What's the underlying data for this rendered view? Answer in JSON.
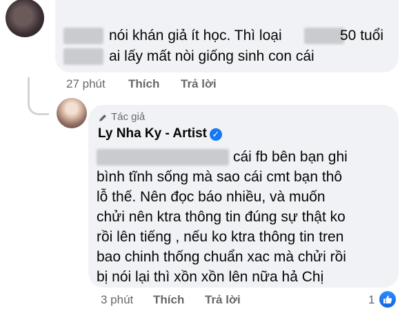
{
  "comment1": {
    "lines": [
      "nói khán giả ít học.  Thì loại",
      "50 tuổi",
      "ai lấy mất nòi giống sinh con cái"
    ],
    "time": "27 phút",
    "like": "Thích",
    "reply": "Trả lời"
  },
  "comment2": {
    "author_tag": "Tác giả",
    "author": "Ly Nha Ky - Artist",
    "lines": [
      "cái fb bên bạn ghi",
      "bình tĩnh sống mà sao cái cmt bạn thô",
      "lỗ thế. Nên đọc báo nhiều, và muốn",
      "chửi nên ktra thông tin đúng sự thật ko",
      "rồi lên tiếng , nếu ko ktra thông tin tren",
      "bao chinh thống chuẩn xac mà chửi rồi",
      "bị nói lại thì xồn xồn  lên nữa hả Chị"
    ],
    "time": "3 phút",
    "like": "Thích",
    "reply": "Trả lời",
    "reaction_count": "1",
    "colors": {
      "verified": "#1877f2",
      "bubble": "#f0f2f5",
      "meta": "#65676b"
    },
    "icons": [
      "pencil-icon",
      "verified-badge-icon",
      "like-reaction-icon"
    ]
  }
}
